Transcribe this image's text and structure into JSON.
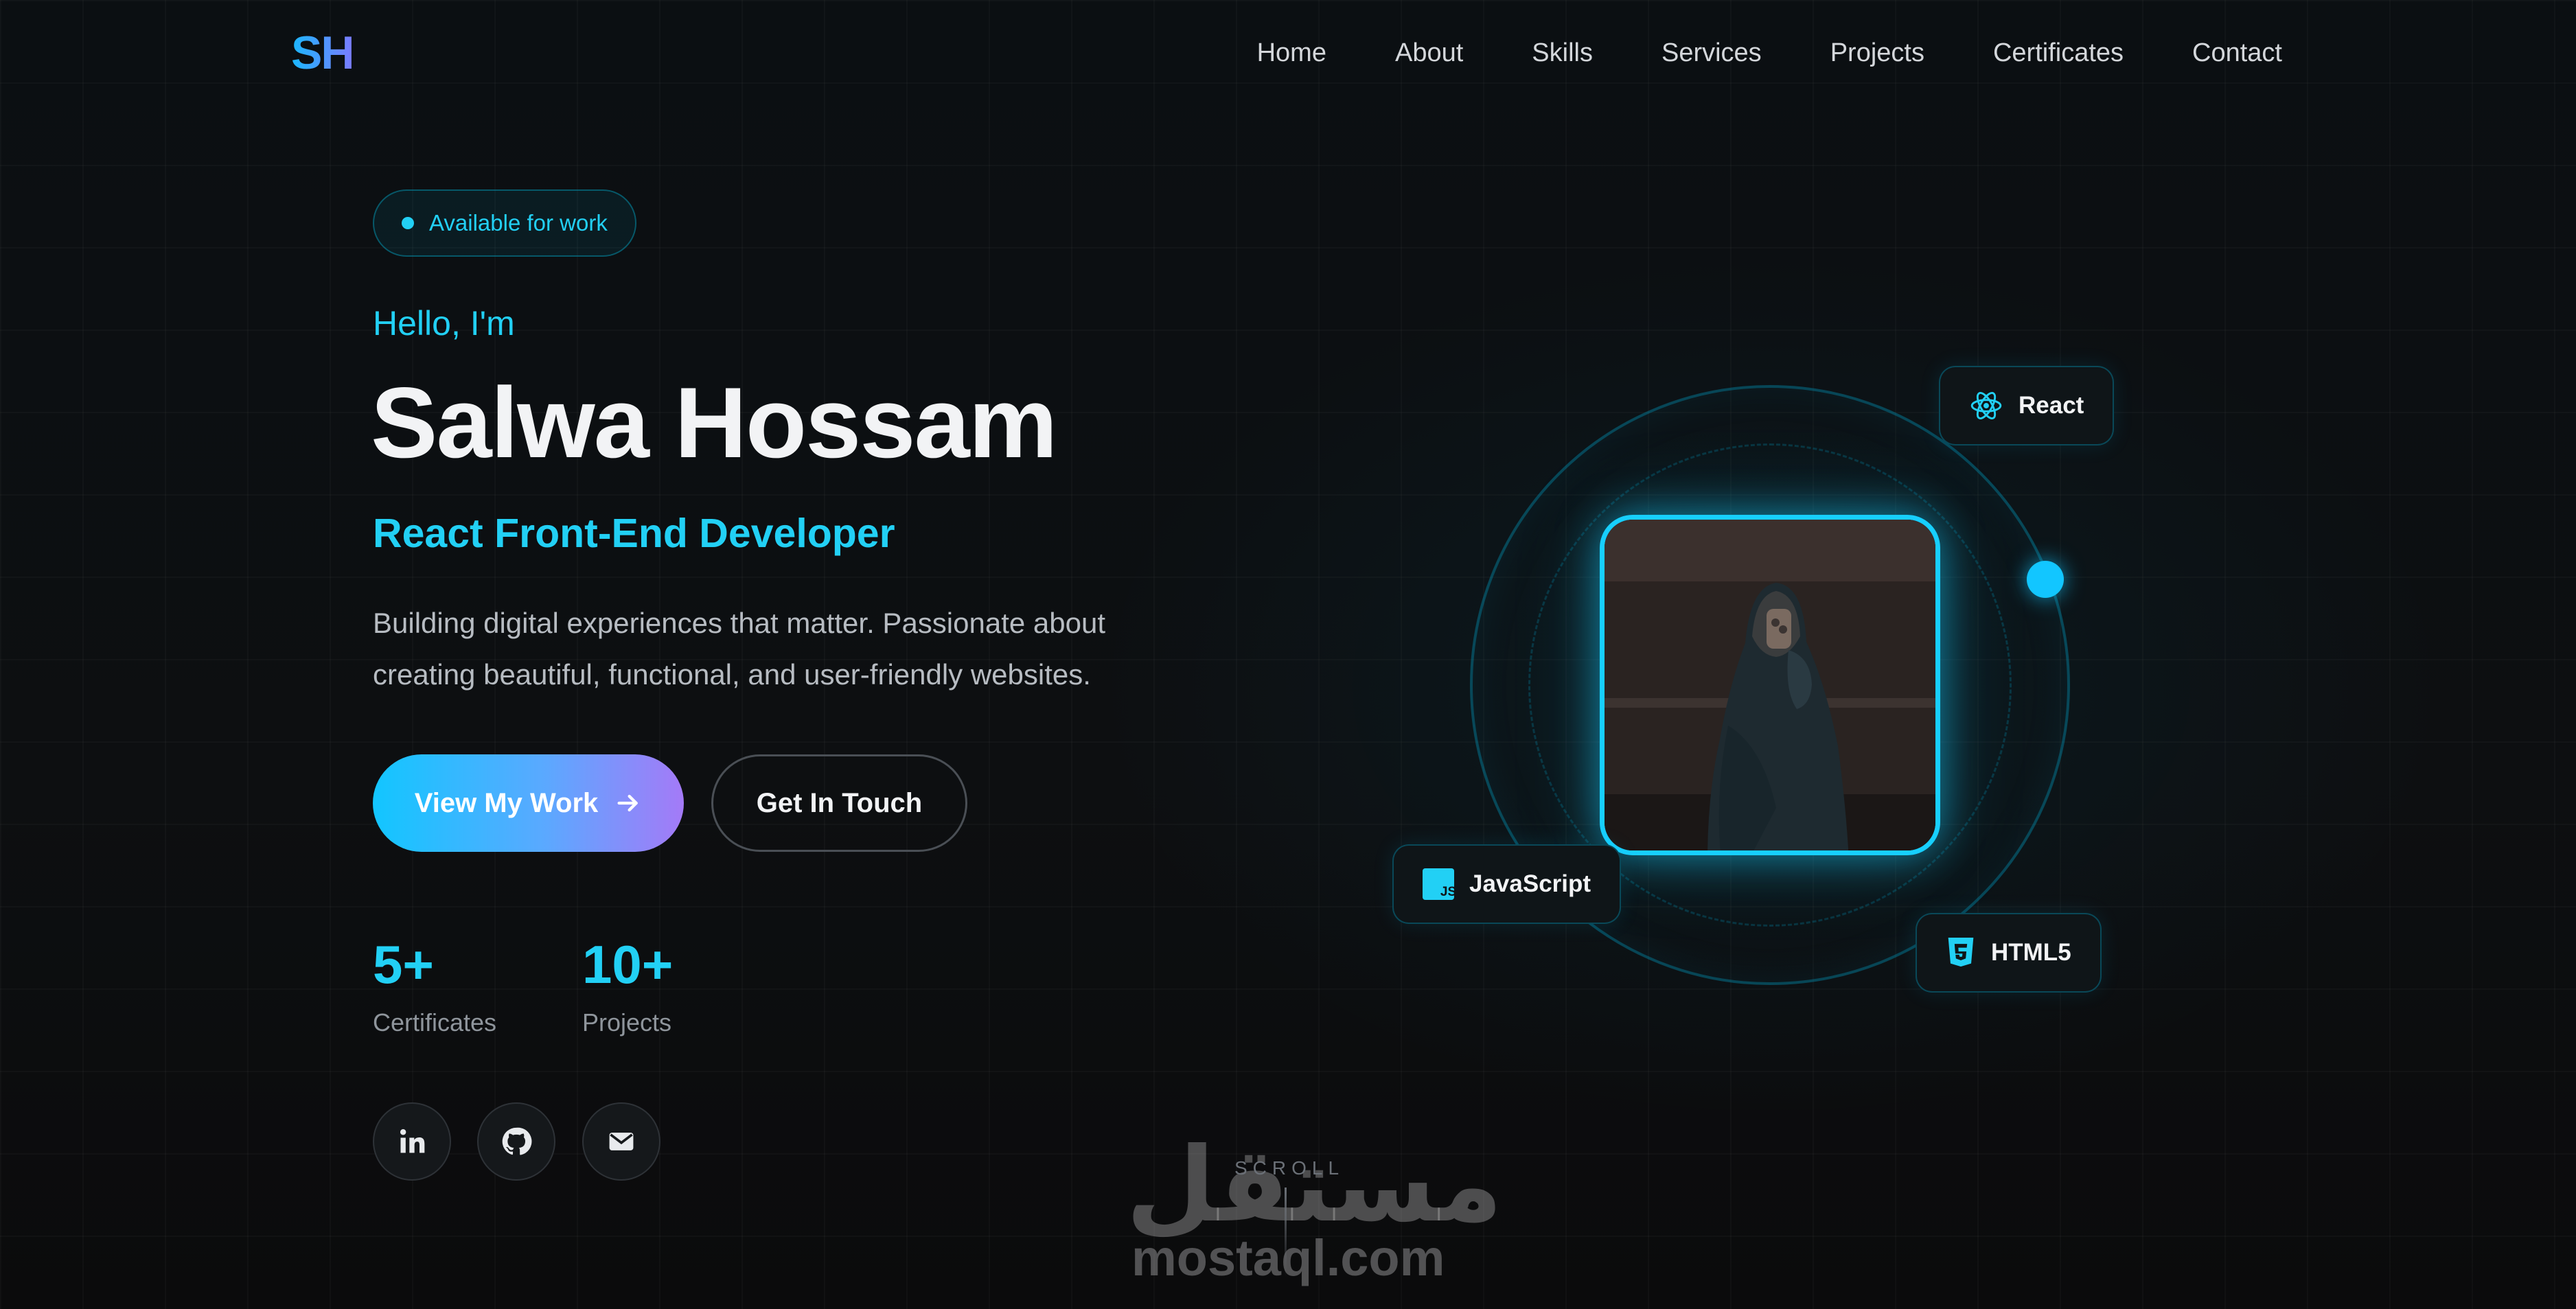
{
  "nav": {
    "logo": "SH",
    "items": [
      "Home",
      "About",
      "Skills",
      "Services",
      "Projects",
      "Certificates",
      "Contact"
    ]
  },
  "hero": {
    "badge": "Available for work",
    "greeting": "Hello, I'm",
    "name": "Salwa Hossam",
    "role": "React Front-End Developer",
    "description_line1": "Building digital experiences that matter. Passionate about",
    "description_line2": "creating beautiful, functional, and user-friendly websites.",
    "primary_button": "View My Work",
    "secondary_button": "Get In Touch",
    "stats": [
      {
        "value": "5+",
        "label": "Certificates"
      },
      {
        "value": "10+",
        "label": "Projects"
      }
    ],
    "social_icons": [
      "linkedin-icon",
      "github-icon",
      "mail-icon"
    ]
  },
  "visual": {
    "tags": [
      {
        "label": "React",
        "icon": "react-icon"
      },
      {
        "label": "JavaScript",
        "icon": "javascript-icon"
      },
      {
        "label": "HTML5",
        "icon": "html5-icon"
      }
    ]
  },
  "scroll": {
    "label": "SCROLL"
  },
  "watermark": {
    "arabic": "مستقل",
    "latin": "mostaql.com"
  },
  "colors": {
    "accent": "#22d0f5",
    "background": "#0c0e10",
    "gradient_end": "#a47af7"
  }
}
